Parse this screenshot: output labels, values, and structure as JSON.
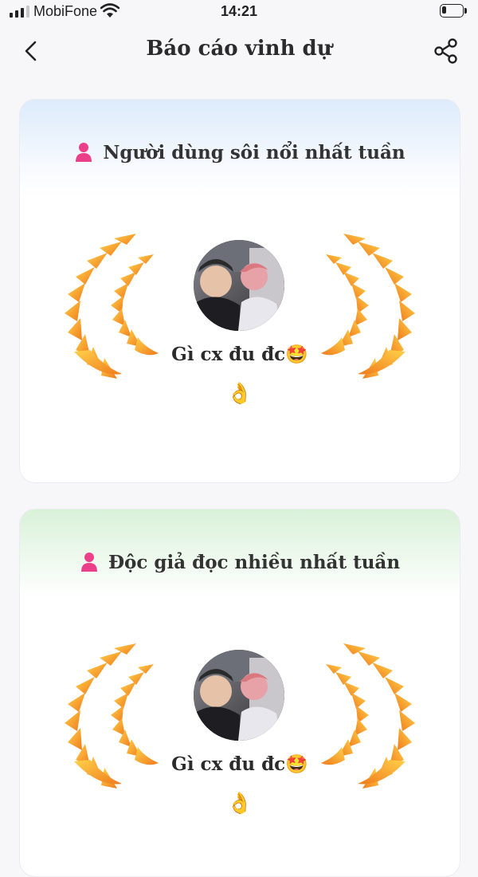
{
  "status_bar": {
    "carrier": "MobiFone",
    "time": "14:21"
  },
  "nav": {
    "title": "Báo cáo vinh dự"
  },
  "cards": [
    {
      "title": "Người dùng sôi nổi nhất tuần",
      "username_line1": "Gì cx đu đc🤩",
      "username_line2": "👌"
    },
    {
      "title": "Độc giả đọc nhiều nhất tuần",
      "username_line1": "Gì cx đu đc🤩",
      "username_line2": "👌"
    }
  ],
  "colors": {
    "accent_pink": "#ec3f8a",
    "laurel_gold": "#f7b52c",
    "laurel_orange": "#f07a1c",
    "card_1_tint": "#dcebfb",
    "card_2_tint": "#d9f1d9"
  },
  "icons": {
    "back": "chevron-left-icon",
    "share": "share-icon",
    "card_header": "user-icon",
    "award": "laurel-wreath-icon"
  }
}
